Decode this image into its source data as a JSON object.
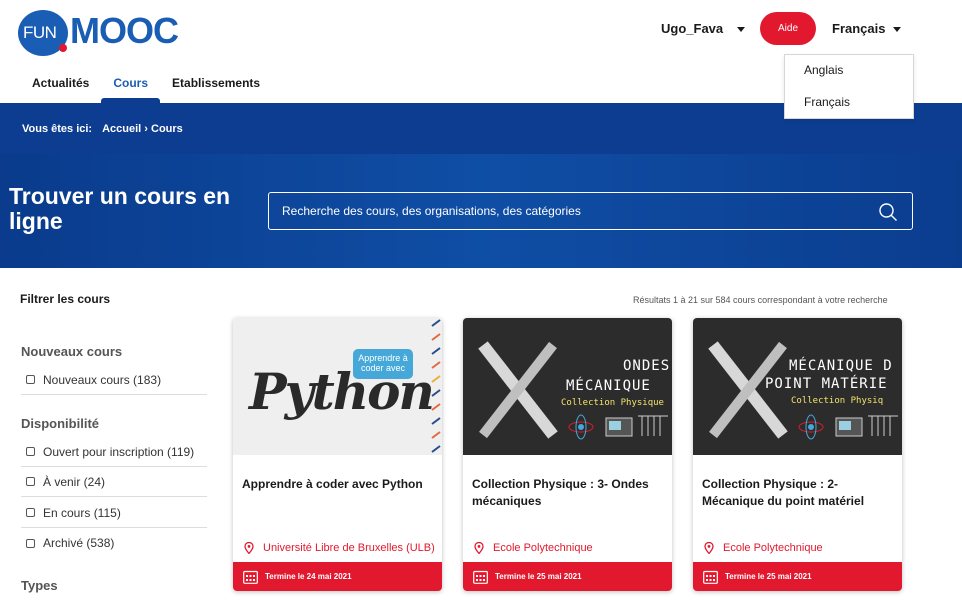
{
  "header": {
    "logo_fun": "FUN",
    "logo_mooc": "MOOC",
    "nav": [
      "Actualités",
      "Cours",
      "Etablissements"
    ],
    "active_nav": "Cours",
    "user": "Ugo_Fava",
    "help_label": "Aide",
    "language": "Français",
    "language_options": [
      "Anglais",
      "Français"
    ]
  },
  "breadcrumb": {
    "prefix": "Vous êtes ici:",
    "path": "Accueil › Cours"
  },
  "hero": {
    "title": "Trouver un cours en ligne",
    "search_placeholder": "Recherche des cours, des organisations, des catégories"
  },
  "filters": {
    "title": "Filtrer les cours",
    "sections": [
      {
        "title": "Nouveaux cours",
        "items": [
          "Nouveaux cours (183)"
        ]
      },
      {
        "title": "Disponibilité",
        "items": [
          "Ouvert pour inscription (119)",
          "À venir (24)",
          "En cours (115)",
          "Archivé (538)"
        ]
      },
      {
        "title": "Types",
        "items": []
      }
    ]
  },
  "results": {
    "count_text": "Résultats 1 à 21 sur 584 cours correspondant à votre recherche",
    "courses": [
      {
        "title": "Apprendre à coder avec Python",
        "org": "Université Libre de Bruxelles (ULB)",
        "date": "Termine le 24 mai 2021",
        "image": {
          "main_text": "Python",
          "bubble_text": "Apprendre à coder avec"
        }
      },
      {
        "title": "Collection Physique : 3- Ondes mécaniques",
        "org": "Ecole Polytechnique",
        "date": "Termine le 25 mai 2021",
        "image": {
          "line1": "ONDES",
          "line2": "MÉCANIQUE",
          "line3": "Collection Physique"
        }
      },
      {
        "title": "Collection Physique : 2- Mécanique du point matériel",
        "org": "Ecole Polytechnique",
        "date": "Termine le 25 mai 2021",
        "image": {
          "line1": "MÉCANIQUE D",
          "line2": "POINT MATÉRIE",
          "line3": "Collection Physiq"
        }
      }
    ]
  },
  "colors": {
    "brand_blue": "#1a5db4",
    "dark_blue": "#0d3d91",
    "accent_red": "#e2192e"
  }
}
